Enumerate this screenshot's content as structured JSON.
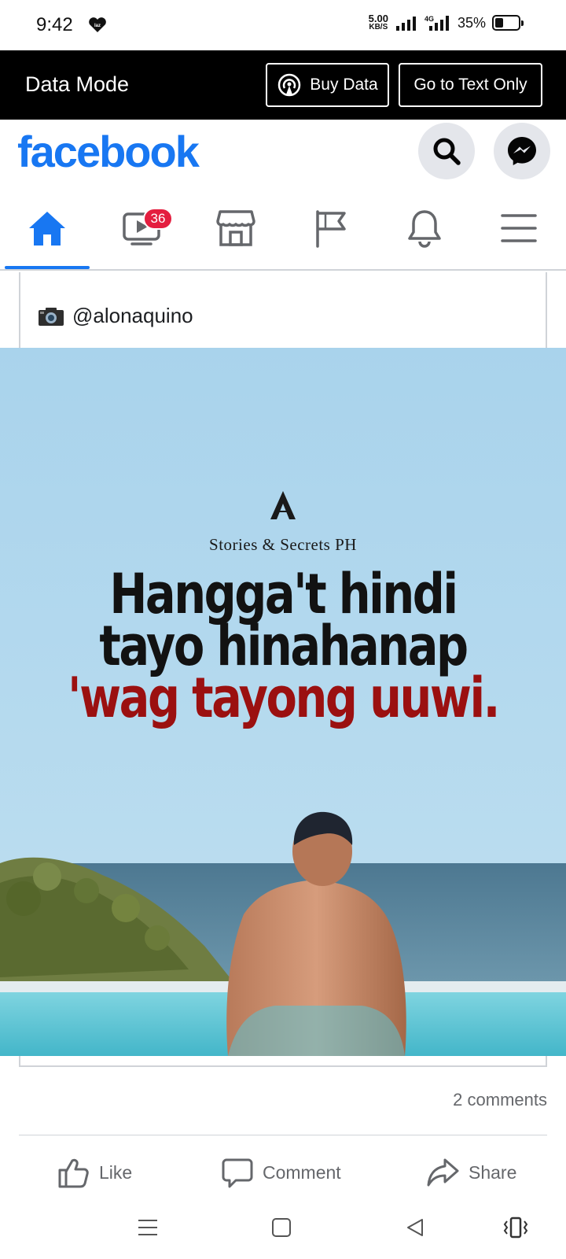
{
  "status_bar": {
    "time": "9:42",
    "notification_icon": "laz-icon",
    "net_speed_value": "5.00",
    "net_speed_unit": "KB/S",
    "network_type": "4G",
    "battery_percent": "35%",
    "battery_level": 0.35
  },
  "data_mode_bar": {
    "label": "Data Mode",
    "buy_data_label": "Buy Data",
    "text_only_label": "Go to Text Only"
  },
  "header": {
    "logo": "facebook",
    "brand_color": "#1877f2"
  },
  "nav": {
    "video_badge": "36",
    "tabs": [
      "home",
      "video",
      "marketplace",
      "pages",
      "notifications",
      "menu"
    ],
    "active_tab": "home"
  },
  "post": {
    "caption": "@alonaquino",
    "photo": {
      "brand": "Stories & Secrets PH",
      "quote_line1": "Hangga't hindi",
      "quote_line2": "tayo hinahanap",
      "quote_line3": "'wag tayong uuwi.",
      "quote_highlight_color": "#9b1010"
    },
    "comments_count": "2 comments",
    "actions": {
      "like": "Like",
      "comment": "Comment",
      "share": "Share"
    }
  }
}
